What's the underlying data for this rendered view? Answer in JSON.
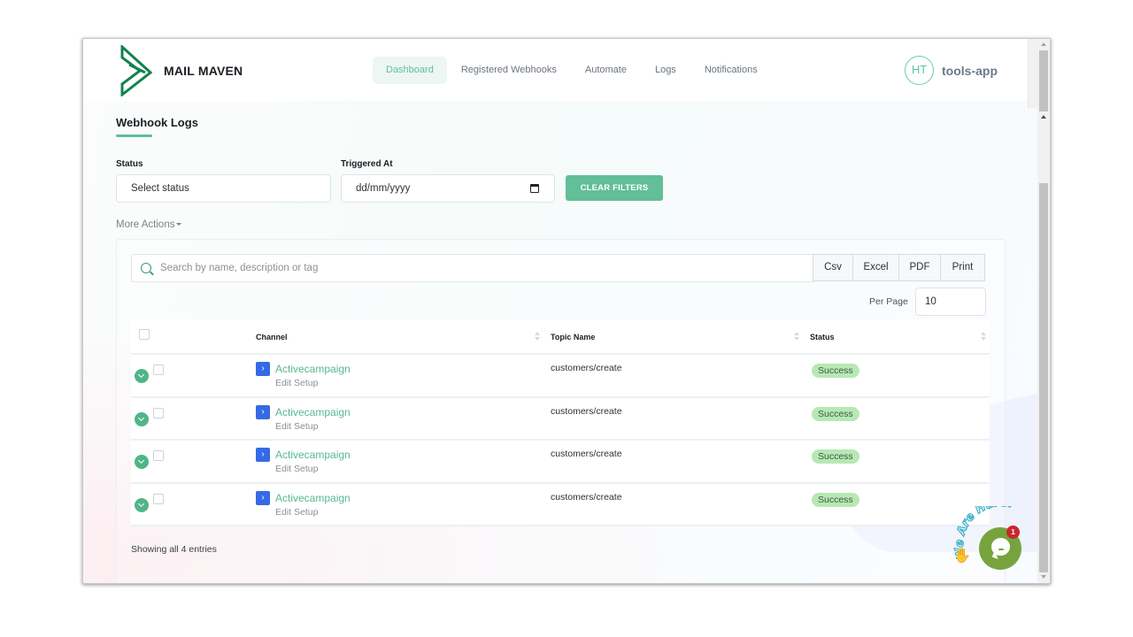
{
  "brand": {
    "name": "MAIL MAVEN",
    "accent_color": "#5cbf98"
  },
  "nav": {
    "items": [
      {
        "label": "Dashboard",
        "active": true
      },
      {
        "label": "Registered Webhooks",
        "active": false
      },
      {
        "label": "Automate",
        "active": false
      },
      {
        "label": "Logs",
        "active": false
      },
      {
        "label": "Notifications",
        "active": false
      }
    ]
  },
  "user": {
    "initials": "HT",
    "name": "tools-app"
  },
  "page": {
    "title": "Webhook Logs"
  },
  "filters": {
    "status_label": "Status",
    "status_value": "Select status",
    "triggered_label": "Triggered At",
    "triggered_placeholder": "dd/mm/yyyy",
    "clear_label": "CLEAR FILTERS",
    "more_actions_label": "More Actions"
  },
  "toolbar": {
    "search_placeholder": "Search by name, description or tag",
    "exports": [
      "Csv",
      "Excel",
      "PDF",
      "Print"
    ],
    "per_page_label": "Per Page",
    "per_page_value": "10"
  },
  "table": {
    "columns": {
      "channel": "Channel",
      "topic": "Topic Name",
      "status": "Status"
    },
    "rows": [
      {
        "channel": "Activecampaign",
        "sub": "Edit Setup",
        "topic": "customers/create",
        "status": "Success"
      },
      {
        "channel": "Activecampaign",
        "sub": "Edit Setup",
        "topic": "customers/create",
        "status": "Success"
      },
      {
        "channel": "Activecampaign",
        "sub": "Edit Setup",
        "topic": "customers/create",
        "status": "Success"
      },
      {
        "channel": "Activecampaign",
        "sub": "Edit Setup",
        "topic": "customers/create",
        "status": "Success"
      }
    ],
    "footer": "Showing all 4 entries"
  },
  "chat": {
    "tagline": "We Are Here!",
    "unread_count": "1"
  },
  "icons": {
    "channel_glyph": "›",
    "wave_glyph": "✋"
  }
}
